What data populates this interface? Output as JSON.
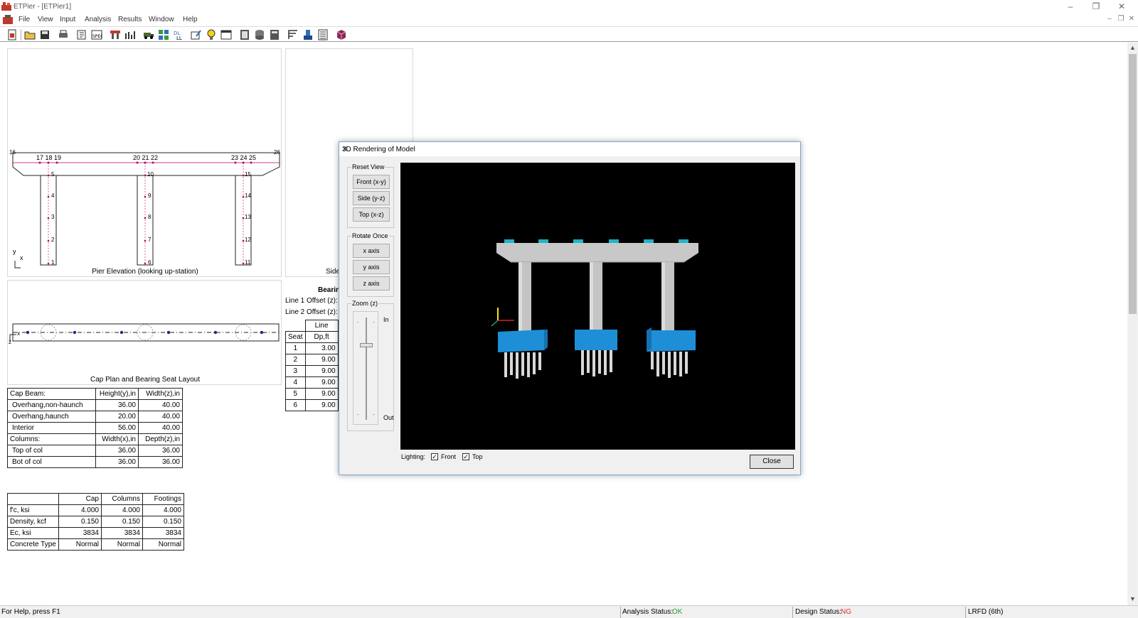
{
  "window": {
    "title": "ETPier - [ETPier1]"
  },
  "menu": [
    "File",
    "View",
    "Input",
    "Analysis",
    "Results",
    "Window",
    "Help"
  ],
  "pier_elevation": {
    "caption": "Pier Elevation (looking up-station)",
    "nodes_top_left": "17 18 19",
    "nodes_top_mid": "20 21 22",
    "nodes_top_right": "23 24 25",
    "node_l": "16",
    "node_r": "26",
    "col1_nodes": [
      "5",
      "4",
      "3",
      "2",
      "1"
    ],
    "col2_nodes": [
      "10",
      "9",
      "8",
      "7",
      "6"
    ],
    "col3_nodes": [
      "15",
      "14",
      "13",
      "12",
      "11"
    ],
    "axis_y": "y",
    "axis_x": "x"
  },
  "side_panel": {
    "caption": "Side"
  },
  "cap_plan": {
    "caption": "Cap Plan and Bearing Seat Layout",
    "axis_x": "x",
    "axis_z": "z"
  },
  "bearing": {
    "title": "Bearir",
    "line1": "Line 1 Offset (z):",
    "line2": "Line 2 Offset (z):",
    "header_line": "Line",
    "header_seat": "Seat",
    "header_dp": "Dp,ft",
    "rows": [
      [
        "1",
        "3.00"
      ],
      [
        "2",
        "9.00"
      ],
      [
        "3",
        "9.00"
      ],
      [
        "4",
        "9.00"
      ],
      [
        "5",
        "9.00"
      ],
      [
        "6",
        "9.00"
      ]
    ]
  },
  "dims_table": {
    "rows": [
      [
        "Cap Beam:",
        "Height(y),in",
        "Width(z),in"
      ],
      [
        "Overhang,non-haunch",
        "36.00",
        "40.00"
      ],
      [
        "Overhang,haunch",
        "20.00",
        "40.00"
      ],
      [
        "Interior",
        "56.00",
        "40.00"
      ],
      [
        "Columns:",
        "Width(x),in",
        "Depth(z),in"
      ],
      [
        "Top of col",
        "36.00",
        "36.00"
      ],
      [
        "Bot of col",
        "36.00",
        "36.00"
      ]
    ]
  },
  "materials_table": {
    "header": [
      "",
      "Cap",
      "Columns",
      "Footings"
    ],
    "rows": [
      [
        "f'c, ksi",
        "4.000",
        "4.000",
        "4.000"
      ],
      [
        "Density, kcf",
        "0.150",
        "0.150",
        "0.150"
      ],
      [
        "Ec, ksi",
        "3834",
        "3834",
        "3834"
      ],
      [
        "Concrete Type",
        "Normal",
        "Normal",
        "Normal"
      ]
    ]
  },
  "dialog": {
    "title": "3D Rendering of Model",
    "reset_view": "Reset View",
    "front": "Front (x-y)",
    "side": "Side (y-z)",
    "top": "Top (x-z)",
    "rotate_once": "Rotate Once",
    "x_axis": "x axis",
    "y_axis": "y axis",
    "z_axis": "z axis",
    "zoom": "Zoom (z)",
    "zoom_in": "In",
    "zoom_out": "Out",
    "lighting": "Lighting:",
    "light_front": "Front",
    "light_top": "Top",
    "close": "Close"
  },
  "status": {
    "help": "For Help, press F1",
    "analysis_label": "Analysis Status:",
    "analysis_value": "OK",
    "design_label": "Design Status:",
    "design_value": "NG",
    "spec": "LRFD (6th)"
  },
  "colors": {
    "ok": "#2e9b2e",
    "ng": "#e03030",
    "footing": "#1e8fd6",
    "pier": "#c8c8c8"
  }
}
